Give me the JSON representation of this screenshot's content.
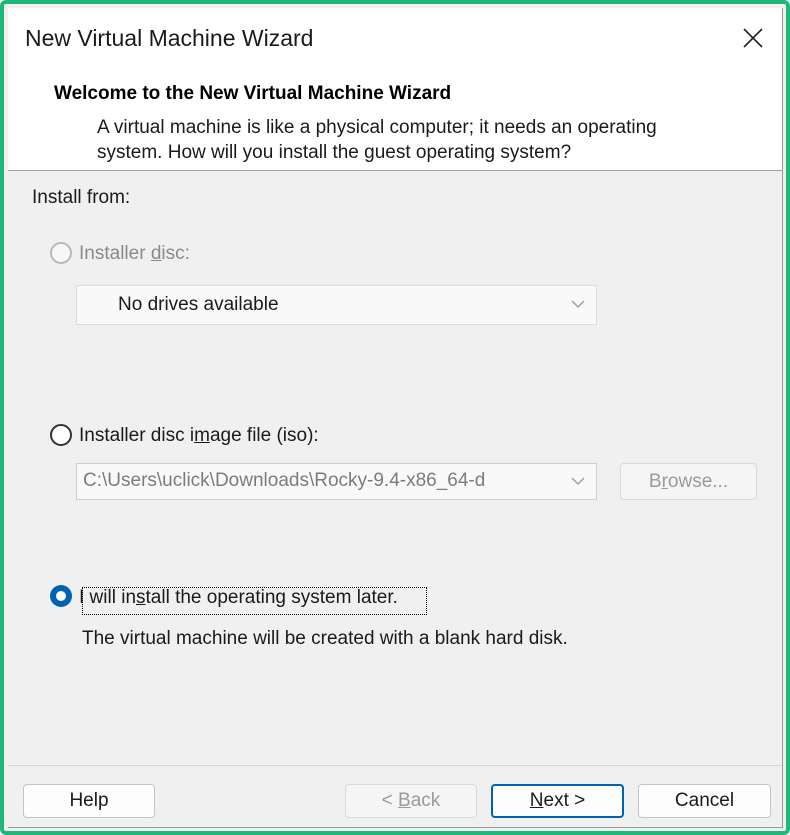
{
  "window": {
    "title": "New Virtual Machine Wizard",
    "close_icon": "close-icon"
  },
  "header": {
    "title": "Welcome to the New Virtual Machine Wizard",
    "description": "A virtual machine is like a physical computer; it needs an operating system. How will you install the guest operating system?"
  },
  "install": {
    "section_label": "Install from:",
    "options": [
      {
        "label_pre": "Installer ",
        "label_ul": "d",
        "label_post": "isc:",
        "enabled": false,
        "selected": false,
        "dropdown_value": "No drives available"
      },
      {
        "label_pre": "Installer disc i",
        "label_ul": "m",
        "label_post": "age file (iso):",
        "enabled": true,
        "selected": false,
        "path_value": "C:\\Users\\uclick\\Downloads\\Rocky-9.4-x86_64-d",
        "browse_pre": "B",
        "browse_ul": "r",
        "browse_post": "owse..."
      },
      {
        "label_pre": "I will in",
        "label_ul": "s",
        "label_post": "tall the operating system later.",
        "enabled": true,
        "selected": true,
        "note": "The virtual machine will be created with a blank hard disk."
      }
    ]
  },
  "footer": {
    "help_label": "Help",
    "back_pre": "< ",
    "back_ul": "B",
    "back_post": "ack",
    "next_ul": "N",
    "next_post": "ext >",
    "cancel_label": "Cancel"
  },
  "colors": {
    "accent": "#0063b1",
    "frame": "#1fb77a"
  }
}
